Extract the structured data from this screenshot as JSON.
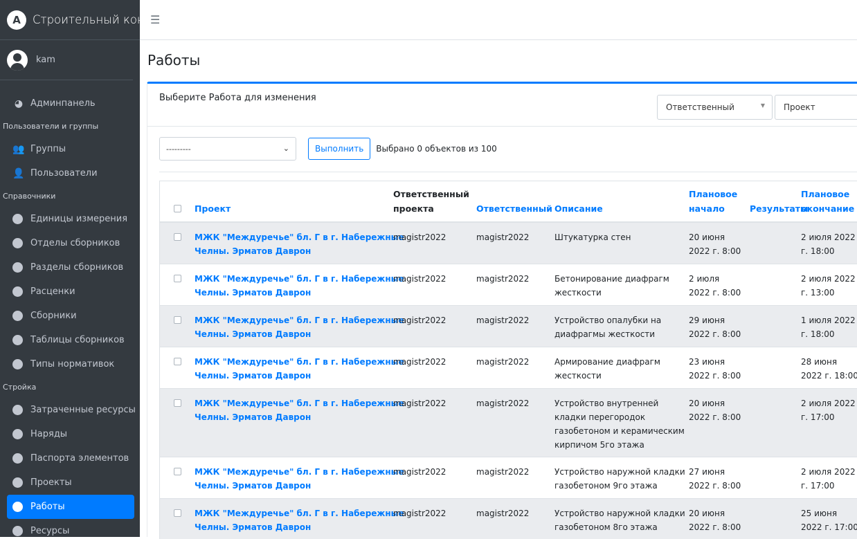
{
  "brand": {
    "title": "Строительный конвейер"
  },
  "user": {
    "name": "kam"
  },
  "sidebar": {
    "admin": "Админпанель",
    "sections": [
      {
        "header": "Пользователи и группы",
        "items": [
          "Группы",
          "Пользователи"
        ]
      },
      {
        "header": "Справочники",
        "items": [
          "Единицы измерения",
          "Отделы сборников",
          "Разделы сборников",
          "Расценки",
          "Сборники",
          "Таблицы сборников",
          "Типы нормативок"
        ]
      },
      {
        "header": "Стройка",
        "items": [
          "Затраченные ресурсы",
          "Наряды",
          "Паспорта элементов",
          "Проекты",
          "Работы",
          "Ресурсы"
        ]
      }
    ],
    "active": "Работы"
  },
  "page": {
    "title": "Работы"
  },
  "card": {
    "select_label": "Выберите Работа для изменения",
    "filters": {
      "responsible": "Ответственный",
      "project": "Проект"
    }
  },
  "actions": {
    "select_value": "---------",
    "run_label": "Выполнить",
    "counter": "Выбрано 0 объектов из 100"
  },
  "table": {
    "headers": {
      "project": "Проект",
      "project_responsible_1": "Ответственный",
      "project_responsible_2": "проекта",
      "responsible": "Ответственный",
      "description": "Описание",
      "planned_start_1": "Плановое",
      "planned_start_2": "начало",
      "results": "Результаты",
      "planned_end_1": "Плановое",
      "planned_end_2": "окончание"
    },
    "rows": [
      {
        "project_1": "МЖК \"Междуречье\" бл. Г в г. Набережные",
        "project_2": "Челны. Эрматов Даврон",
        "proj_resp": "magistr2022",
        "resp": "magistr2022",
        "desc": [
          "Штукатурка стен"
        ],
        "start_1": "20 июня",
        "start_2": "2022 г. 8:00",
        "end_1": "2 июля 2022",
        "end_2": "г. 18:00"
      },
      {
        "project_1": "МЖК \"Междуречье\" бл. Г в г. Набережные",
        "project_2": "Челны. Эрматов Даврон",
        "proj_resp": "magistr2022",
        "resp": "magistr2022",
        "desc": [
          "Бетонирование диафрагм",
          "жесткости"
        ],
        "start_1": "2 июля",
        "start_2": "2022 г. 8:00",
        "end_1": "2 июля 2022",
        "end_2": "г. 13:00"
      },
      {
        "project_1": "МЖК \"Междуречье\" бл. Г в г. Набережные",
        "project_2": "Челны. Эрматов Даврон",
        "proj_resp": "magistr2022",
        "resp": "magistr2022",
        "desc": [
          "Устройство опалубки на",
          "диафрагмы жесткости"
        ],
        "start_1": "29 июня",
        "start_2": "2022 г. 8:00",
        "end_1": "1 июля 2022",
        "end_2": "г. 18:00"
      },
      {
        "project_1": "МЖК \"Междуречье\" бл. Г в г. Набережные",
        "project_2": "Челны. Эрматов Даврон",
        "proj_resp": "magistr2022",
        "resp": "magistr2022",
        "desc": [
          "Армирование диафрагм",
          "жесткости"
        ],
        "start_1": "23 июня",
        "start_2": "2022 г. 8:00",
        "end_1": "28 июня",
        "end_2": "2022 г. 18:00"
      },
      {
        "project_1": "МЖК \"Междуречье\" бл. Г в г. Набережные",
        "project_2": "Челны. Эрматов Даврон",
        "proj_resp": "magistr2022",
        "resp": "magistr2022",
        "desc": [
          "Устройство внутренней",
          "кладки перегородок",
          "газобетоном и керамическим",
          "кирпичом 5го этажа"
        ],
        "start_1": "20 июня",
        "start_2": "2022 г. 8:00",
        "end_1": "2 июля 2022",
        "end_2": "г. 17:00"
      },
      {
        "project_1": "МЖК \"Междуречье\" бл. Г в г. Набережные",
        "project_2": "Челны. Эрматов Даврон",
        "proj_resp": "magistr2022",
        "resp": "magistr2022",
        "desc": [
          "Устройство наружной кладки",
          "газобетоном 9го этажа"
        ],
        "start_1": "27 июня",
        "start_2": "2022 г. 8:00",
        "end_1": "2 июля 2022",
        "end_2": "г. 17:00"
      },
      {
        "project_1": "МЖК \"Междуречье\" бл. Г в г. Набережные",
        "project_2": "Челны. Эрматов Даврон",
        "proj_resp": "magistr2022",
        "resp": "magistr2022",
        "desc": [
          "Устройство наружной кладки",
          "газобетоном 8го этажа"
        ],
        "start_1": "20 июня",
        "start_2": "2022 г. 8:00",
        "end_1": "25 июня",
        "end_2": "2022 г. 17:00"
      }
    ]
  }
}
